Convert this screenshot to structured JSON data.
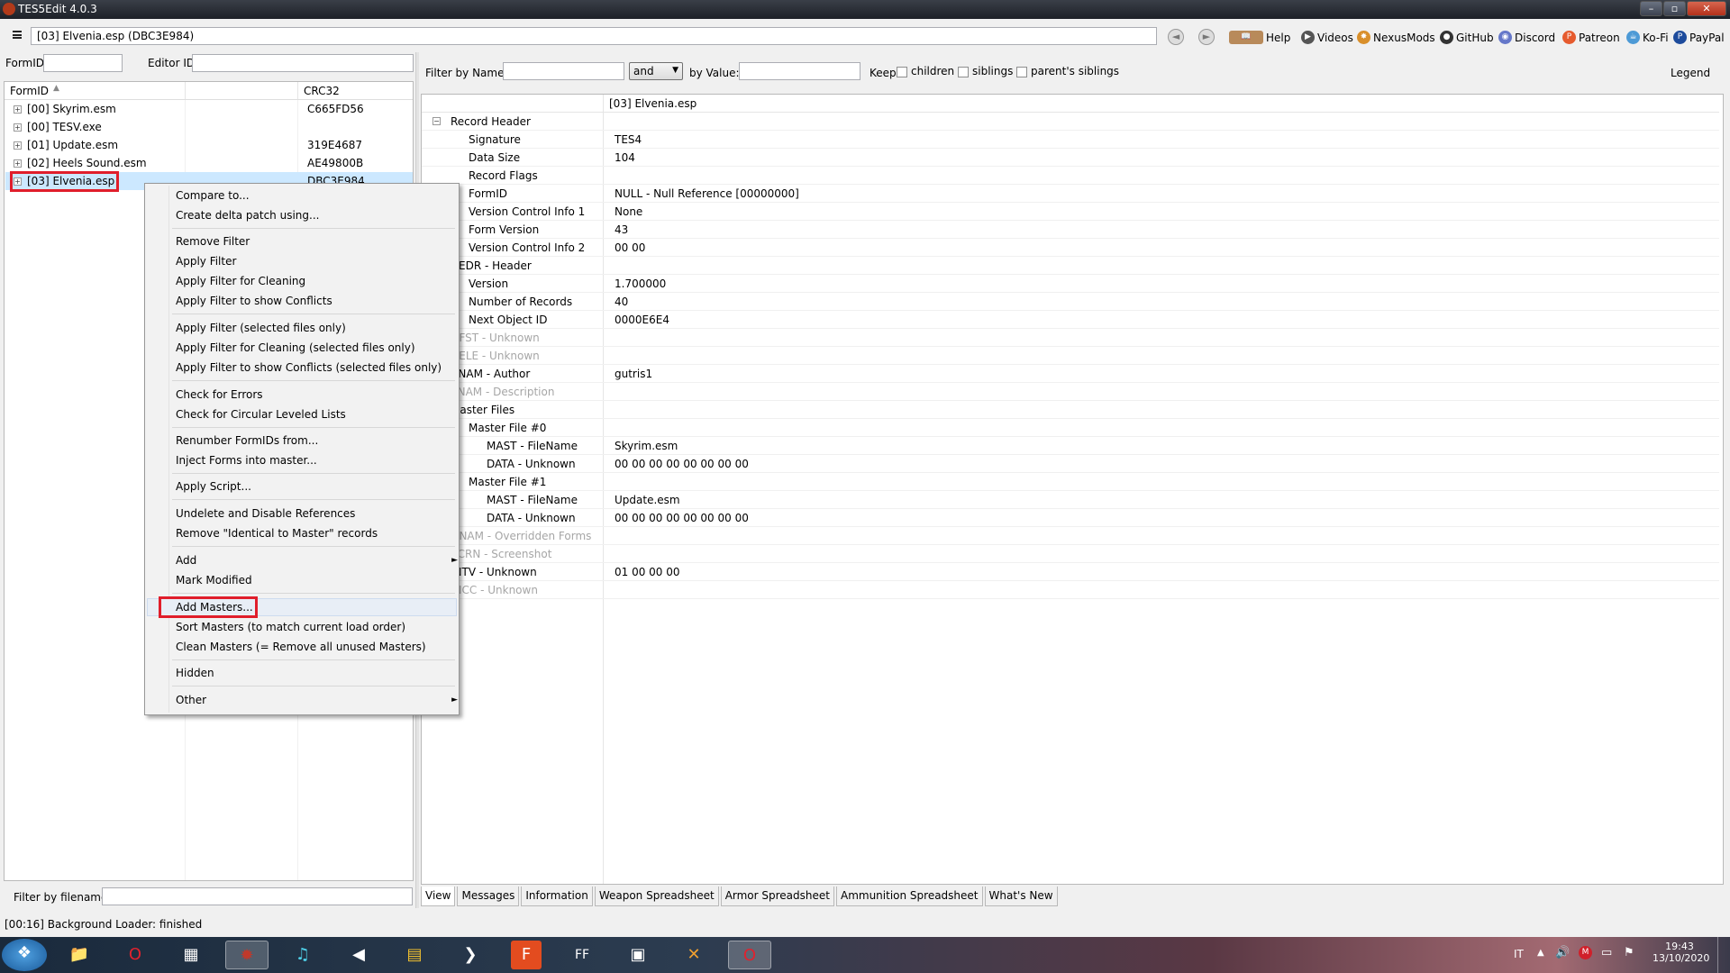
{
  "window": {
    "title": "TES5Edit 4.0.3"
  },
  "toolbar": {
    "path": "[03] Elvenia.esp (DBC3E984)",
    "links": [
      {
        "label": "Help",
        "icon": "book-icon"
      },
      {
        "label": "Videos",
        "icon": "videos-icon"
      },
      {
        "label": "NexusMods",
        "icon": "nexusmods-icon"
      },
      {
        "label": "GitHub",
        "icon": "github-icon"
      },
      {
        "label": "Discord",
        "icon": "discord-icon"
      },
      {
        "label": "Patreon",
        "icon": "patreon-icon"
      },
      {
        "label": "Ko-Fi",
        "icon": "kofi-icon"
      },
      {
        "label": "PayPal",
        "icon": "paypal-icon"
      }
    ]
  },
  "left": {
    "formid_label": "FormID",
    "editorid_label": "Editor ID",
    "col_formid": "FormID",
    "col_crc": "CRC32",
    "files": [
      {
        "name": "[00] Skyrim.esm",
        "crc": "C665FD56"
      },
      {
        "name": "[00] TESV.exe",
        "crc": ""
      },
      {
        "name": "[01] Update.esm",
        "crc": "319E4687"
      },
      {
        "name": "[02] Heels Sound.esm",
        "crc": "AE49800B"
      },
      {
        "name": "[03] Elvenia.esp",
        "crc": "DBC3E984"
      }
    ],
    "filter_label": "Filter by filename:"
  },
  "filterbar": {
    "name_label": "Filter by Name:",
    "op": "and",
    "value_label": "by Value:",
    "keep": "Keep",
    "children": "children",
    "siblings": "siblings",
    "parents": "parent's siblings",
    "legend": "Legend"
  },
  "menu": {
    "items": [
      "Compare to...",
      "Create delta patch using...",
      "Remove Filter",
      "Apply Filter",
      "Apply Filter for Cleaning",
      "Apply Filter to show Conflicts",
      "Apply Filter (selected files only)",
      "Apply Filter for Cleaning (selected files only)",
      "Apply Filter to show Conflicts (selected files only)",
      "Check for Errors",
      "Check for Circular Leveled Lists",
      "Renumber FormIDs from...",
      "Inject Forms into master...",
      "Apply Script...",
      "Undelete and Disable References",
      "Remove \"Identical to Master\" records",
      "Add",
      "Mark Modified",
      "Add Masters...",
      "Sort Masters (to match current load order)",
      "Clean Masters (= Remove all unused Masters)",
      "Hidden",
      "Other"
    ]
  },
  "view": {
    "header": "[03] Elvenia.esp",
    "rows": [
      {
        "name": "Record Header",
        "value": ""
      },
      {
        "name": "Signature",
        "value": "TES4"
      },
      {
        "name": "Data Size",
        "value": "104"
      },
      {
        "name": "Record Flags",
        "value": ""
      },
      {
        "name": "FormID",
        "value": "NULL - Null Reference [00000000]"
      },
      {
        "name": "Version Control Info 1",
        "value": "None"
      },
      {
        "name": "Form Version",
        "value": "43"
      },
      {
        "name": "Version Control Info 2",
        "value": "00 00"
      },
      {
        "name": "HEDR - Header",
        "value": ""
      },
      {
        "name": "Version",
        "value": "1.700000"
      },
      {
        "name": "Number of Records",
        "value": "40"
      },
      {
        "name": "Next Object ID",
        "value": "0000E6E4"
      },
      {
        "name": "OFST - Unknown",
        "value": ""
      },
      {
        "name": "DELE - Unknown",
        "value": ""
      },
      {
        "name": "CNAM - Author",
        "value": "gutris1"
      },
      {
        "name": "SNAM - Description",
        "value": ""
      },
      {
        "name": "Master Files",
        "value": ""
      },
      {
        "name": "Master File #0",
        "value": ""
      },
      {
        "name": "MAST - FileName",
        "value": "Skyrim.esm"
      },
      {
        "name": "DATA - Unknown",
        "value": "00 00 00 00 00 00 00 00"
      },
      {
        "name": "Master File #1",
        "value": ""
      },
      {
        "name": "MAST - FileName",
        "value": "Update.esm"
      },
      {
        "name": "DATA - Unknown",
        "value": "00 00 00 00 00 00 00 00"
      },
      {
        "name": "ONAM - Overridden Forms",
        "value": ""
      },
      {
        "name": "SCRN - Screenshot",
        "value": ""
      },
      {
        "name": "INTV - Unknown",
        "value": "01 00 00 00"
      },
      {
        "name": "INCC - Unknown",
        "value": ""
      }
    ]
  },
  "tabs": [
    "View",
    "Messages",
    "Information",
    "Weapon Spreadsheet",
    "Armor Spreadsheet",
    "Ammunition Spreadsheet",
    "What's New"
  ],
  "status": "[00:16] Background Loader: finished",
  "taskbar": {
    "lang": "IT",
    "time": "19:43",
    "date": "13/10/2020"
  }
}
